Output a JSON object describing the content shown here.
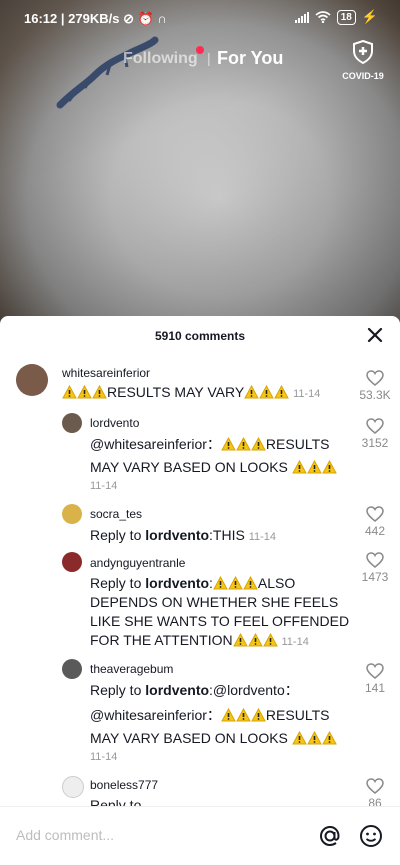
{
  "status": {
    "time": "16:12",
    "speed": "279KB/s",
    "battery": "18"
  },
  "nav": {
    "following": "Following",
    "for_you": "For You",
    "covid": "COVID-19"
  },
  "sheet": {
    "title": "5910 comments",
    "close_icon": "close-icon"
  },
  "comments": [
    {
      "user": "whitesareinferior",
      "pre": "",
      "text": "RESULTS MAY VARY",
      "date": "11-14",
      "likes": "53.3K"
    },
    {
      "user": "lordvento",
      "line1": "@whitesareinferior：",
      "line1b": "RESULTS",
      "line2": "MAY VARY BASED ON LOOKS",
      "date": "11-14",
      "likes": "3152"
    },
    {
      "user": "socra_tes",
      "reply": "Reply to ",
      "to": "lordvento",
      "text": ":THIS",
      "date": "11-14",
      "likes": "442"
    },
    {
      "user": "andynguyentranle",
      "reply": "Reply to ",
      "to": "lordvento",
      "line1": ":",
      "line1b": "ALSO",
      "line2": "DEPENDS ON WHETHER SHE FEELS",
      "line3": "LIKE SHE WANTS TO FEEL OFFENDED",
      "line4": "FOR THE ATTENTION",
      "date": "11-14",
      "likes": "1473"
    },
    {
      "user": "theaveragebum",
      "reply": "Reply to ",
      "to": "lordvento",
      "line1": ":@lordvento：",
      "line2": "@whitesareinferior：",
      "line2b": "RESULTS",
      "line3": "MAY VARY BASED ON LOOKS",
      "date": "11-14",
      "likes": "141"
    },
    {
      "user": "boneless777",
      "reply": "Reply to",
      "likes": "86"
    }
  ],
  "input": {
    "placeholder": "Add comment..."
  },
  "colors": {
    "accent": "#fe2c55",
    "warning": "#f5c518"
  }
}
